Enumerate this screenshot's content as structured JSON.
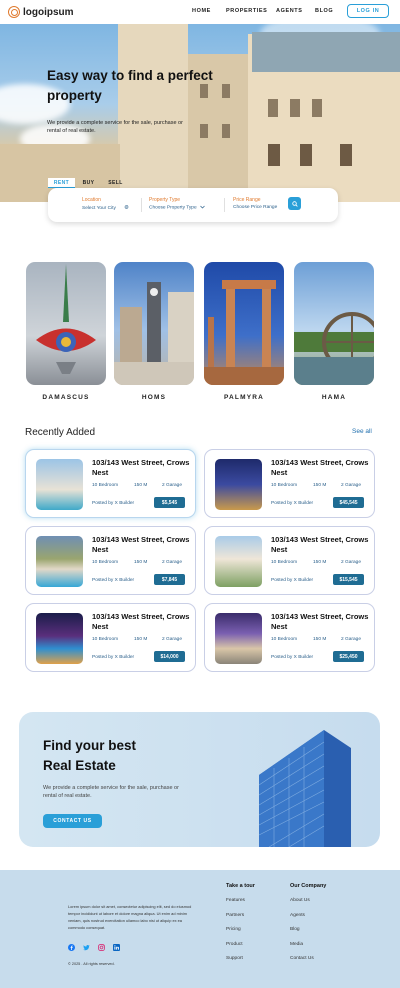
{
  "colors": {
    "accent": "#2a9fd8",
    "brand_orange": "#e07a2e",
    "price_bg": "#1f6c93",
    "footer_bg": "#c7dcec"
  },
  "nav": {
    "logo": "logoipsum",
    "links": [
      "HOME",
      "PROPERTIES",
      "AGENTS",
      "BLOG"
    ],
    "login": "LOG IN"
  },
  "hero": {
    "title": "Easy way to find a perfect property",
    "subtitle": "We provide a complete service for the sale, purchase or rental of real estate."
  },
  "search": {
    "tabs": [
      "RENT",
      "BUY",
      "SELL"
    ],
    "active_tab": "RENT",
    "location_label": "Location",
    "location_value": "Select Your City",
    "type_label": "Property Type",
    "type_value": "Choose Property Type",
    "price_label": "Price Range",
    "price_value": "Choose Price Range",
    "icons": {
      "location": "location-pin-icon",
      "type": "chevron-down-icon",
      "search": "search-icon"
    }
  },
  "cities": [
    "DAMASCUS",
    "HOMS",
    "PALMYRA",
    "HAMA"
  ],
  "recent": {
    "title": "Recently Added",
    "see_all": "See all",
    "listings": [
      {
        "title": "103/143 West Street, Crows Nest",
        "bedrooms": "10 Bedroom",
        "area": "150 M",
        "garage": "2 Garage",
        "posted": "Posted by X Builder",
        "price": "$5,545"
      },
      {
        "title": "103/143 West Street, Crows Nest",
        "bedrooms": "10 Bedroom",
        "area": "150 M",
        "garage": "2 Garage",
        "posted": "Posted by X Builder",
        "price": "$45,545"
      },
      {
        "title": "103/143 West Street, Crows Nest",
        "bedrooms": "10 Bedroom",
        "area": "150 M",
        "garage": "2 Garage",
        "posted": "Posted by X Builder",
        "price": "$7,845"
      },
      {
        "title": "103/143 West Street, Crows Nest",
        "bedrooms": "10 Bedroom",
        "area": "150 M",
        "garage": "2 Garage",
        "posted": "Posted by X Builder",
        "price": "$15,545"
      },
      {
        "title": "103/143 West Street, Crows Nest",
        "bedrooms": "10 Bedroom",
        "area": "150 M",
        "garage": "2 Garage",
        "posted": "Posted by X Builder",
        "price": "$14,000"
      },
      {
        "title": "103/143 West Street, Crows Nest",
        "bedrooms": "10 Bedroom",
        "area": "150 M",
        "garage": "2 Garage",
        "posted": "Posted by X Builder",
        "price": "$25,450"
      }
    ]
  },
  "promo": {
    "title_line1": "Find your best",
    "title_line2": "Real Estate",
    "subtitle": "We provide a complete service for the sale, purchase or rental of real estate.",
    "button": "CONTACT US"
  },
  "footer": {
    "text": "Lorem ipsum dolor sit amet, consectetur adipiscing elit, sed do eiusmod tempor incididunt ut labore et dolore magna aliqua. Ut enim ad minim veniam, quis nostrud exercitation ullamco labo nisi ut aliquip ex ea commodo consequat.",
    "copyright": "© 2025 . All rights reserved.",
    "socials": [
      "facebook-icon",
      "twitter-icon",
      "instagram-icon",
      "linkedin-icon"
    ],
    "col1": {
      "heading": "Take a tour",
      "items": [
        "Features",
        "Partners",
        "Pricing",
        "Product",
        "Support"
      ]
    },
    "col2": {
      "heading": "Our Company",
      "items": [
        "About Us",
        "Agents",
        "Blog",
        "Media",
        "Contact Us"
      ]
    }
  }
}
